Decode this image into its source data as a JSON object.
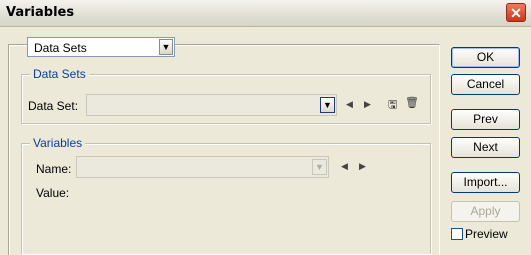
{
  "window": {
    "title": "Variables",
    "close_label": "✕"
  },
  "mode_select": {
    "value": "Data Sets"
  },
  "datasets_group": {
    "legend": "Data Sets",
    "dataset_label": "Data Set:",
    "dataset_value": ""
  },
  "variables_group": {
    "legend": "Variables",
    "name_label": "Name:",
    "value_label": "Value:",
    "name_value": ""
  },
  "buttons": {
    "ok": "OK",
    "cancel": "Cancel",
    "prev": "Prev",
    "next": "Next",
    "import": "Import...",
    "apply": "Apply"
  },
  "preview": {
    "label": "Preview",
    "checked": false
  },
  "icons": {
    "dropdown": "▼",
    "prev_arrow": "◀",
    "next_arrow": "▶",
    "save_dataset": "🖫",
    "delete_dataset": "🗑"
  }
}
